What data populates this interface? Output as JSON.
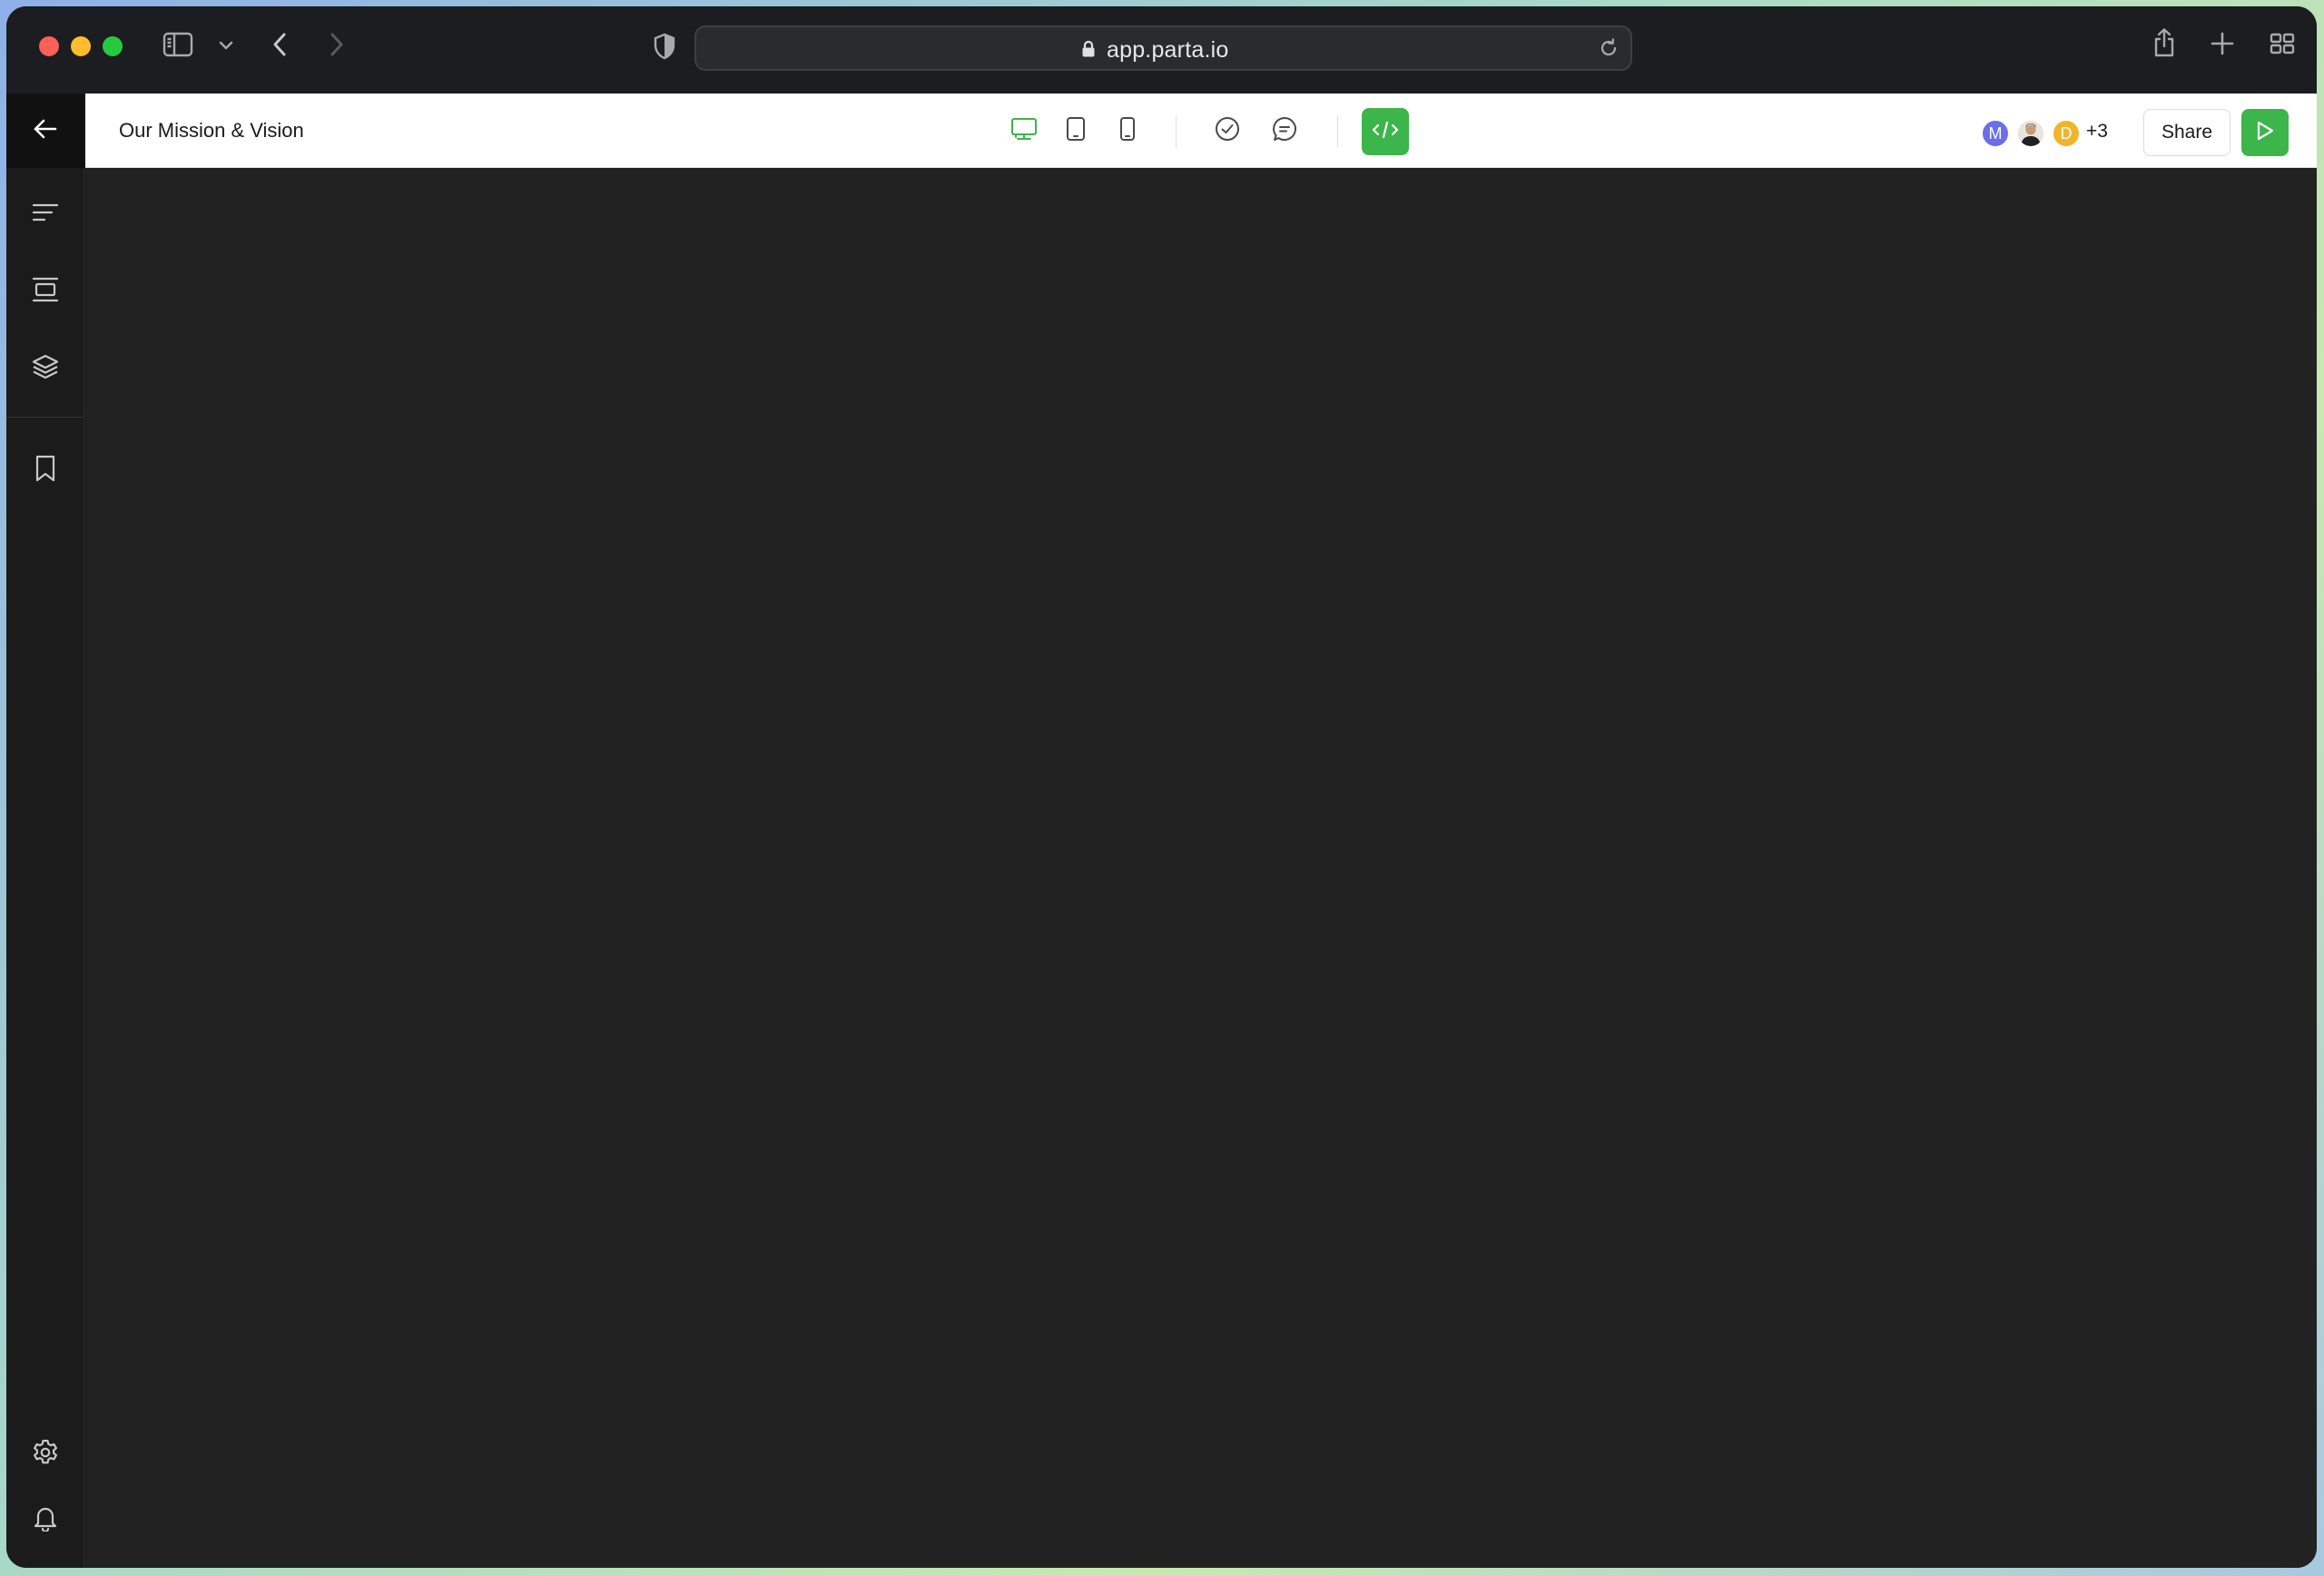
{
  "browser": {
    "url": "app.parta.io",
    "icons": [
      "sidebar-toggle-icon",
      "chevron-down-icon",
      "back-arrow-icon",
      "forward-arrow-icon",
      "privacy-shield-icon",
      "lock-icon",
      "reload-icon",
      "share-icon",
      "new-tab-plus-icon",
      "tab-overview-icon"
    ]
  },
  "app": {
    "document_title": "Our Mission & Vision",
    "toolbar": {
      "device_modes": [
        "desktop",
        "tablet",
        "mobile"
      ],
      "active_device": "desktop",
      "share_label": "Share",
      "collaborators": [
        {
          "initial": "M",
          "color": "#6a6ee8"
        },
        {
          "initial": "",
          "color": "#e9e4dc"
        },
        {
          "initial": "D",
          "color": "#f0b52a"
        }
      ],
      "more_collaborators": "+3"
    },
    "rail": {
      "items": [
        "back",
        "outline",
        "sections",
        "layers",
        "bookmarks",
        "settings",
        "notifications"
      ]
    },
    "colors": {
      "accent": "#3cb54a",
      "canvas": "#222222"
    }
  }
}
